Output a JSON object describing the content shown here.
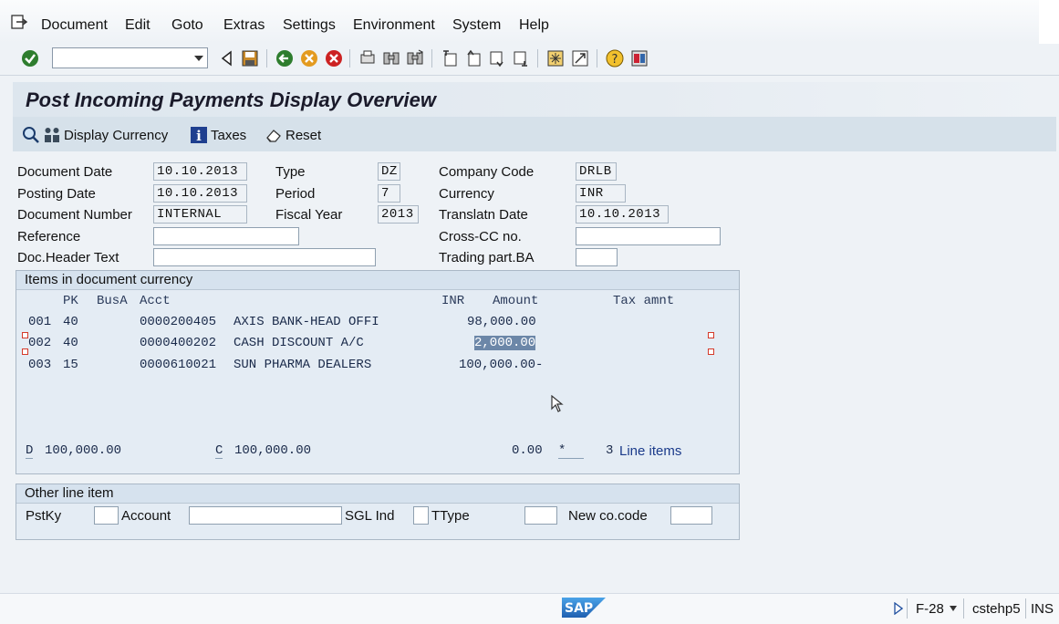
{
  "menubar": {
    "items": [
      "Document",
      "Edit",
      "Goto",
      "Extras",
      "Settings",
      "Environment",
      "System",
      "Help"
    ]
  },
  "toolbar": {
    "command_field_value": ""
  },
  "screen": {
    "title": "Post Incoming Payments Display Overview"
  },
  "app_toolbar": {
    "display_currency_label": "Display Currency",
    "taxes_label": "Taxes",
    "reset_label": "Reset"
  },
  "header": {
    "document_date": {
      "label": "Document Date",
      "value": "10.10.2013"
    },
    "posting_date": {
      "label": "Posting Date",
      "value": "10.10.2013"
    },
    "document_number": {
      "label": "Document Number",
      "value": "INTERNAL"
    },
    "reference": {
      "label": "Reference",
      "value": ""
    },
    "doc_header_text": {
      "label": "Doc.Header Text",
      "value": ""
    },
    "type": {
      "label": "Type",
      "value": "DZ"
    },
    "period": {
      "label": "Period",
      "value": "7"
    },
    "fiscal_year": {
      "label": "Fiscal Year",
      "value": "2013"
    },
    "company_code": {
      "label": "Company Code",
      "value": "DRLB"
    },
    "currency": {
      "label": "Currency",
      "value": "INR"
    },
    "translatn_date": {
      "label": "Translatn Date",
      "value": "10.10.2013"
    },
    "cross_cc": {
      "label": "Cross-CC no.",
      "value": ""
    },
    "trading_part": {
      "label": "Trading part.BA",
      "value": ""
    }
  },
  "items_group": {
    "title": "Items in document currency",
    "columns": {
      "pk": "PK",
      "busa": "BusA",
      "acct": "Acct",
      "currency": "INR",
      "amount": "Amount",
      "tax": "Tax amnt"
    },
    "rows": [
      {
        "no": "001",
        "pk": "40",
        "acct": "0000200405",
        "name": "AXIS BANK-HEAD OFFI",
        "amount": "98,000.00"
      },
      {
        "no": "002",
        "pk": "40",
        "acct": "0000400202",
        "name": "CASH DISCOUNT A/C",
        "amount": "2,000.00"
      },
      {
        "no": "003",
        "pk": "15",
        "acct": "0000610021",
        "name": "SUN PHARMA DEALERS",
        "amount": "100,000.00-"
      }
    ],
    "totals": {
      "d_label": "D",
      "d_value": "100,000.00",
      "c_label": "C",
      "c_value": "100,000.00",
      "balance": "0.00",
      "star": "*",
      "line_items_count": "3",
      "line_items_label": "Line items"
    }
  },
  "other_group": {
    "title": "Other line item",
    "pstky_label": "PstKy",
    "account_label": "Account",
    "sgl_label": "SGL Ind",
    "ttype_label": "TType",
    "newcc_label": "New co.code"
  },
  "statusbar": {
    "logo_text": "SAP",
    "transaction": "F-28",
    "server": "cstehp5",
    "mode": "INS"
  },
  "colors": {
    "background": "#eef2f6",
    "title_bar": "#dde6ee",
    "selection": "#6c87a8",
    "sap_logo": "#1f6fc0"
  }
}
